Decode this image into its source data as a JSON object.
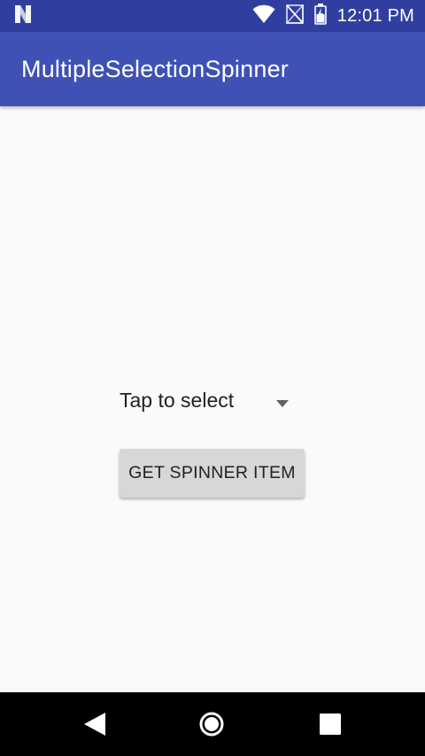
{
  "status_bar": {
    "time": "12:01 PM",
    "icons": [
      "n-logo-icon",
      "wifi-icon",
      "no-signal-icon",
      "battery-icon"
    ],
    "color": "#303f9f"
  },
  "app_bar": {
    "title": "MultipleSelectionSpinner",
    "color": "#3f51b5"
  },
  "main": {
    "spinner": {
      "selected_text": "Tap to select",
      "icon": "dropdown-arrow-icon"
    },
    "button": {
      "label": "GET SPINNER ITEM"
    }
  },
  "nav_bar": {
    "buttons": [
      "back-icon",
      "home-icon",
      "recents-icon"
    ]
  }
}
